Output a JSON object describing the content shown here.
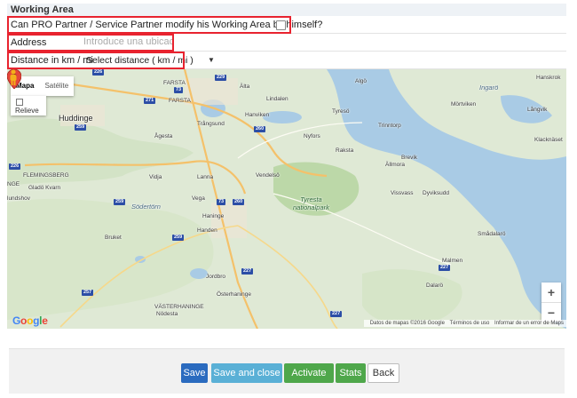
{
  "section": {
    "title": "Working Area"
  },
  "fields": {
    "modify_question": "Can PRO Partner / Service Partner modify his Working Area by himself?",
    "address_label": "Address",
    "address_placeholder": "Introduce una ubicación",
    "distance_label": "Distance in km / mi",
    "distance_selected": "Select distance ( km / mi )"
  },
  "map": {
    "type_map": "Mapa",
    "type_satellite": "Satélite",
    "relief_label": "Relieve",
    "places": {
      "huddinge": "Huddinge",
      "farsta": "FARSTA",
      "alta": "Älta",
      "lindalen": "Lindalen",
      "hanviken": "Hanviken",
      "trangsund": "Trångsund",
      "agesta": "Ågesta",
      "tyreso": "Tyresö",
      "trinntorp": "Trinntorp",
      "nyfors": "Nyfors",
      "raksta": "Raksta",
      "brevik": "Brevik",
      "allmora": "Ällmora",
      "flemingsberg": "FLEMINGSBERG",
      "gladokvarn": "Gladö Kvarn",
      "vidja": "Vidja",
      "lanna": "Lanna",
      "vendelso": "Vendelsö",
      "vega": "Vega",
      "sodertorn": "Södertörn",
      "haninge": "Haninge",
      "handen": "Handen",
      "tyresta": "Tyresta\nnationalpark",
      "vissvass": "Vissvass",
      "dyviksudd": "Dyviksudd",
      "smadalaro": "Smådalarö",
      "bruket": "Bruket",
      "jordbro": "Jordbro",
      "osterhaninge": "Österhaninge",
      "vasterhaninge": "VÄSTERHANINGE",
      "nodesta": "Nödesta",
      "malmen": "Malmen",
      "dalaro": "Dalarö",
      "algo": "Algö",
      "ingaro": "Ingarö",
      "mortviken": "Mörtviken",
      "hanskrok": "Hanskrok",
      "langvik": "Långvik",
      "klacknaset": "Klacknäset",
      "undshov": "lundshov",
      "farsta2": "FARSTA",
      "nge": "NGE"
    },
    "shields": [
      "226",
      "73",
      "229",
      "271",
      "260",
      "259",
      "226",
      "73",
      "260",
      "259",
      "259",
      "227",
      "257",
      "227",
      "227"
    ],
    "google": "Google",
    "attribution_data": "Datos de mapas ©2016 Google",
    "attribution_terms": "Términos de uso",
    "attribution_report": "Informar de un error de Maps"
  },
  "buttons": {
    "save": "Save",
    "save_close": "Save and close",
    "activate": "Activate",
    "stats": "Stats",
    "back": "Back"
  },
  "colors": {
    "highlight": "#e8232f",
    "save": "#2b6bbf",
    "save_close": "#5ab0d6",
    "activate": "#4fa74b",
    "water": "#a9cbe5",
    "land": "#dfe9d5"
  }
}
